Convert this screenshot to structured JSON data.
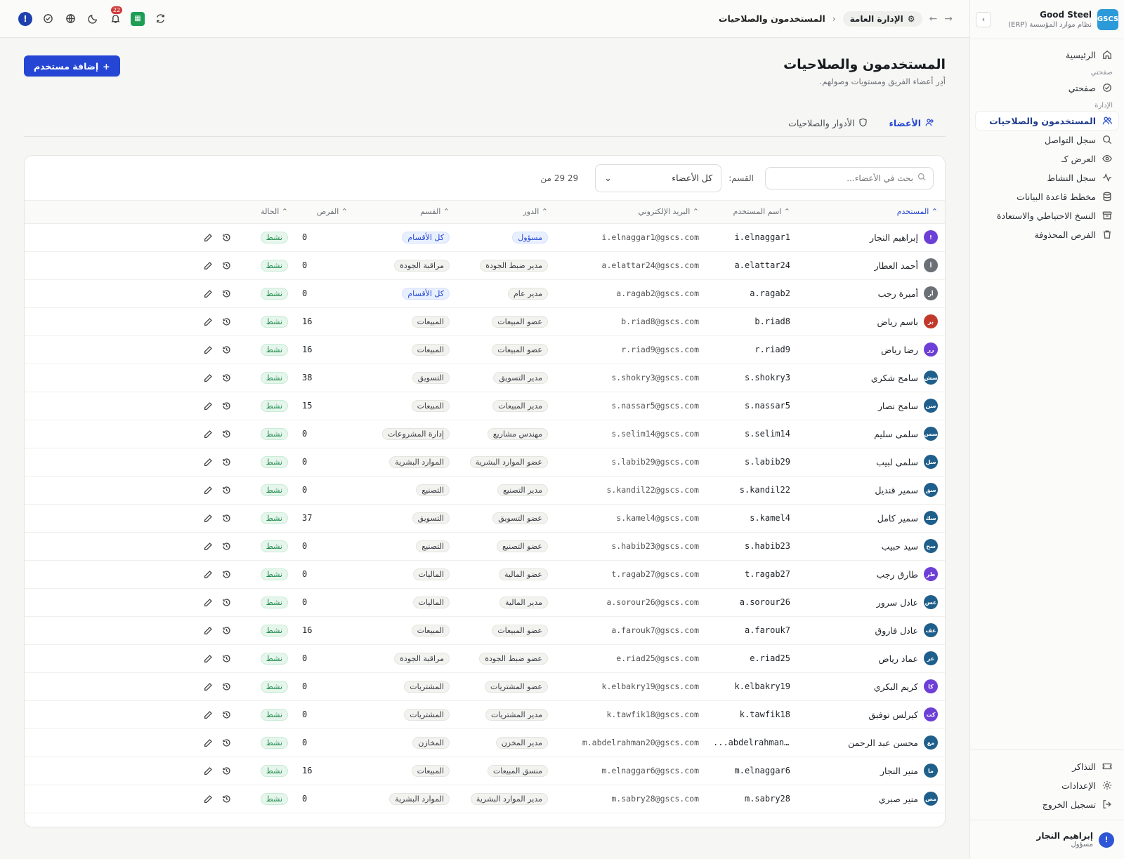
{
  "brand": {
    "logo": "GSCS",
    "name": "Good Steel",
    "sub": "نظام موارد المؤسسة (ERP)"
  },
  "nav": {
    "home": "الرئيسية",
    "section_pages": "صفحتي",
    "checker": "صفحتي",
    "section_admin": "الإدارة",
    "users": "المستخدمون والصلاحيات",
    "contacts_log": "سجل التواصل",
    "view_as": "العرض كـ",
    "activity_log": "سجل النشاط",
    "db_schema": "مخطط قاعدة البيانات",
    "backup": "النسخ الاحتياطي والاستعادة",
    "deleted": "الفرص المحذوفة",
    "tickets": "التذاكر",
    "settings": "الإعدادات",
    "logout": "تسجيل الخروج"
  },
  "current_user": {
    "initial": "!",
    "name": "إبراهيم النجار",
    "role": "مسؤول"
  },
  "topbar": {
    "notif_count": "22",
    "crumb_section": "الإدارة العامة",
    "crumb_current": "المستخدمون والصلاحيات"
  },
  "page": {
    "title": "المستخدمون والصلاحيات",
    "subtitle": "أدِر أعضاء الفريق ومستويات وصولهم.",
    "add_button": "إضافة مستخدم",
    "tab_members": "الأعضاء",
    "tab_roles": "الأدوار والصلاحيات"
  },
  "filters": {
    "search_placeholder": "بحث في الأعضاء...",
    "department_label": "القسم:",
    "department_value": "كل الأعضاء",
    "count_text": "29  29  من"
  },
  "columns": {
    "user": "المستخدم",
    "login": "اسم المستخدم",
    "email": "البريد الإلكتروني",
    "role": "الدور",
    "department": "القسم",
    "opportunities": "الفرص",
    "status": "الحالة"
  },
  "rows": [
    {
      "initial": "!",
      "color": "#6d3fd6",
      "name": "إبراهيم النجار",
      "login": "i.elnaggar1",
      "email": "i.elnaggar1@gscs.com",
      "role": "مسؤول",
      "role_blue": true,
      "dept": "كل الأقسام",
      "dept_blue": true,
      "opps": "0",
      "status": "نشط"
    },
    {
      "initial": "أ",
      "color": "#6b6f76",
      "name": "أحمد العطار",
      "login": "a.elattar24",
      "email": "a.elattar24@gscs.com",
      "role": "مدير ضبط الجودة",
      "role_blue": false,
      "dept": "مراقبة الجودة",
      "dept_blue": false,
      "opps": "0",
      "status": "نشط"
    },
    {
      "initial": "أر",
      "color": "#6b6f76",
      "name": "أميرة رجب",
      "login": "a.ragab2",
      "email": "a.ragab2@gscs.com",
      "role": "مدير عام",
      "role_blue": false,
      "dept": "كل الأقسام",
      "dept_blue": true,
      "opps": "0",
      "status": "نشط"
    },
    {
      "initial": "بر",
      "color": "#c0392b",
      "name": "باسم رياض",
      "login": "b.riad8",
      "email": "b.riad8@gscs.com",
      "role": "عضو المبيعات",
      "role_blue": false,
      "dept": "المبيعات",
      "dept_blue": false,
      "opps": "16",
      "status": "نشط"
    },
    {
      "initial": "رر",
      "color": "#6d3fd6",
      "name": "رضا رياض",
      "login": "r.riad9",
      "email": "r.riad9@gscs.com",
      "role": "عضو المبيعات",
      "role_blue": false,
      "dept": "المبيعات",
      "dept_blue": false,
      "opps": "16",
      "status": "نشط"
    },
    {
      "initial": "سش",
      "color": "#1f5f8b",
      "name": "سامح شكري",
      "login": "s.shokry3",
      "email": "s.shokry3@gscs.com",
      "role": "مدير التسويق",
      "role_blue": false,
      "dept": "التسويق",
      "dept_blue": false,
      "opps": "38",
      "status": "نشط"
    },
    {
      "initial": "سن",
      "color": "#1f5f8b",
      "name": "سامح نصار",
      "login": "s.nassar5",
      "email": "s.nassar5@gscs.com",
      "role": "مدير المبيعات",
      "role_blue": false,
      "dept": "المبيعات",
      "dept_blue": false,
      "opps": "15",
      "status": "نشط"
    },
    {
      "initial": "سس",
      "color": "#1f5f8b",
      "name": "سلمى سليم",
      "login": "s.selim14",
      "email": "s.selim14@gscs.com",
      "role": "مهندس مشاريع",
      "role_blue": false,
      "dept": "إدارة المشروعات",
      "dept_blue": false,
      "opps": "0",
      "status": "نشط"
    },
    {
      "initial": "سل",
      "color": "#1f5f8b",
      "name": "سلمى لبيب",
      "login": "s.labib29",
      "email": "s.labib29@gscs.com",
      "role": "عضو الموارد البشرية",
      "role_blue": false,
      "dept": "الموارد البشرية",
      "dept_blue": false,
      "opps": "0",
      "status": "نشط"
    },
    {
      "initial": "سق",
      "color": "#1f5f8b",
      "name": "سمير قنديل",
      "login": "s.kandil22",
      "email": "s.kandil22@gscs.com",
      "role": "مدير التصنيع",
      "role_blue": false,
      "dept": "التصنيع",
      "dept_blue": false,
      "opps": "0",
      "status": "نشط"
    },
    {
      "initial": "سك",
      "color": "#1f5f8b",
      "name": "سمير كامل",
      "login": "s.kamel4",
      "email": "s.kamel4@gscs.com",
      "role": "عضو التسويق",
      "role_blue": false,
      "dept": "التسويق",
      "dept_blue": false,
      "opps": "37",
      "status": "نشط"
    },
    {
      "initial": "سح",
      "color": "#1f5f8b",
      "name": "سيد حبيب",
      "login": "s.habib23",
      "email": "s.habib23@gscs.com",
      "role": "عضو التصنيع",
      "role_blue": false,
      "dept": "التصنيع",
      "dept_blue": false,
      "opps": "0",
      "status": "نشط"
    },
    {
      "initial": "طر",
      "color": "#6d3fd6",
      "name": "طارق رجب",
      "login": "t.ragab27",
      "email": "t.ragab27@gscs.com",
      "role": "عضو المالية",
      "role_blue": false,
      "dept": "الماليات",
      "dept_blue": false,
      "opps": "0",
      "status": "نشط"
    },
    {
      "initial": "عس",
      "color": "#1f5f8b",
      "name": "عادل سرور",
      "login": "a.sorour26",
      "email": "a.sorour26@gscs.com",
      "role": "مدير المالية",
      "role_blue": false,
      "dept": "الماليات",
      "dept_blue": false,
      "opps": "0",
      "status": "نشط"
    },
    {
      "initial": "عف",
      "color": "#1f5f8b",
      "name": "عادل فاروق",
      "login": "a.farouk7",
      "email": "a.farouk7@gscs.com",
      "role": "عضو المبيعات",
      "role_blue": false,
      "dept": "المبيعات",
      "dept_blue": false,
      "opps": "16",
      "status": "نشط"
    },
    {
      "initial": "عر",
      "color": "#1f5f8b",
      "name": "عماد رياض",
      "login": "e.riad25",
      "email": "e.riad25@gscs.com",
      "role": "عضو ضبط الجودة",
      "role_blue": false,
      "dept": "مراقبة الجودة",
      "dept_blue": false,
      "opps": "0",
      "status": "نشط"
    },
    {
      "initial": "كا",
      "color": "#6d3fd6",
      "name": "كريم البكري",
      "login": "k.elbakry19",
      "email": "k.elbakry19@gscs.com",
      "role": "عضو المشتريات",
      "role_blue": false,
      "dept": "المشتريات",
      "dept_blue": false,
      "opps": "0",
      "status": "نشط"
    },
    {
      "initial": "كت",
      "color": "#6d3fd6",
      "name": "كيرلس توفيق",
      "login": "k.tawfik18",
      "email": "k.tawfik18@gscs.com",
      "role": "مدير المشتريات",
      "role_blue": false,
      "dept": "المشتريات",
      "dept_blue": false,
      "opps": "0",
      "status": "نشط"
    },
    {
      "initial": "مع",
      "color": "#1f5f8b",
      "name": "محسن عبد الرحمن",
      "login": "...abdelrahman20",
      "email": "m.abdelrahman20@gscs.com",
      "role": "مدير المخزن",
      "role_blue": false,
      "dept": "المخازن",
      "dept_blue": false,
      "opps": "0",
      "status": "نشط"
    },
    {
      "initial": "ما",
      "color": "#1f5f8b",
      "name": "منير النجار",
      "login": "m.elnaggar6",
      "email": "m.elnaggar6@gscs.com",
      "role": "منسق المبيعات",
      "role_blue": false,
      "dept": "المبيعات",
      "dept_blue": false,
      "opps": "16",
      "status": "نشط"
    },
    {
      "initial": "مص",
      "color": "#1f5f8b",
      "name": "منير صبري",
      "login": "m.sabry28",
      "email": "m.sabry28@gscs.com",
      "role": "مدير الموارد البشرية",
      "role_blue": false,
      "dept": "الموارد البشرية",
      "dept_blue": false,
      "opps": "0",
      "status": "نشط"
    }
  ]
}
